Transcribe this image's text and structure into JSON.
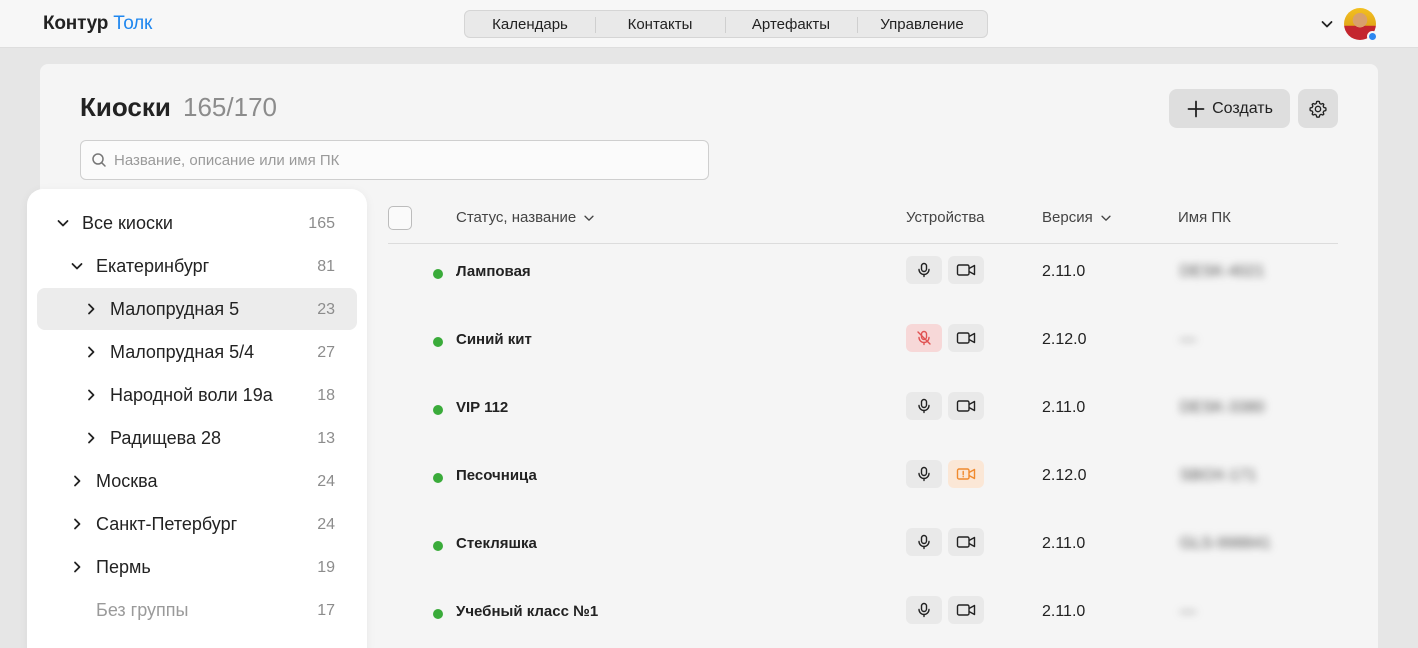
{
  "header": {
    "logo_main": "Контур",
    "logo_accent": "Толк",
    "tabs": [
      "Календарь",
      "Контакты",
      "Артефакты",
      "Управление"
    ]
  },
  "page": {
    "title": "Киоски",
    "count": "165/170",
    "create_label": "Создать",
    "search_placeholder": "Название, описание или имя ПК"
  },
  "tree": [
    {
      "label": "Все киоски",
      "count": "165"
    },
    {
      "label": "Екатеринбург",
      "count": "81"
    },
    {
      "label": "Малопрудная 5",
      "count": "23"
    },
    {
      "label": "Малопрудная 5/4",
      "count": "27"
    },
    {
      "label": "Народной воли 19а",
      "count": "18"
    },
    {
      "label": "Радищева 28",
      "count": "13"
    },
    {
      "label": "Москва",
      "count": "24"
    },
    {
      "label": "Санкт-Петербург",
      "count": "24"
    },
    {
      "label": "Пермь",
      "count": "19"
    },
    {
      "label": "Без группы",
      "count": "17"
    }
  ],
  "table": {
    "headers": {
      "status_name": "Статус, название",
      "devices": "Устройства",
      "version": "Версия",
      "pc_name": "Имя ПК"
    },
    "rows": [
      {
        "name": "Ламповая",
        "mic": "ok",
        "cam": "ok",
        "version": "2.11.0",
        "pc": "DESK-4021"
      },
      {
        "name": "Синий кит",
        "mic": "off",
        "cam": "ok",
        "version": "2.12.0",
        "pc": "—"
      },
      {
        "name": "VIP 112",
        "mic": "ok",
        "cam": "ok",
        "version": "2.11.0",
        "pc": "DESK-3380"
      },
      {
        "name": "Песочница",
        "mic": "ok",
        "cam": "warn",
        "version": "2.12.0",
        "pc": "SBOX-171"
      },
      {
        "name": "Стекляшка",
        "mic": "ok",
        "cam": "ok",
        "version": "2.11.0",
        "pc": "GLS-998841"
      },
      {
        "name": "Учебный класс №1",
        "mic": "ok",
        "cam": "ok",
        "version": "2.11.0",
        "pc": "—"
      }
    ]
  },
  "colors": {
    "accent": "#1f87ef",
    "status_online": "#3aab3a",
    "mic_off": "#e05252",
    "cam_warn": "#f08a2e"
  }
}
